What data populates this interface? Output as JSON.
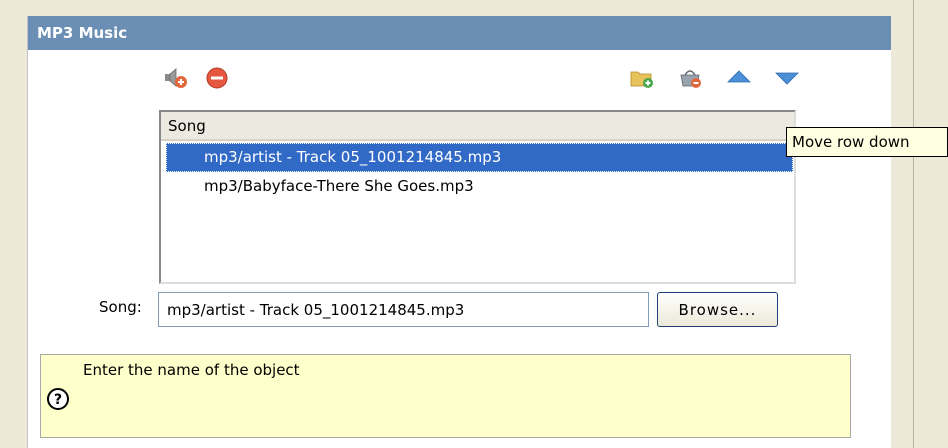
{
  "section": {
    "title": "MP3 Music"
  },
  "toolbar": {
    "left_icons": [
      "speaker-add-icon",
      "remove-icon"
    ],
    "right_icons": [
      "folder-add-icon",
      "basket-remove-icon",
      "move-up-icon",
      "move-down-icon"
    ]
  },
  "list": {
    "column_header": "Song",
    "rows": [
      {
        "value": "mp3/artist - Track 05_1001214845.mp3",
        "selected": true
      },
      {
        "value": "mp3/Babyface-There She Goes.mp3",
        "selected": false
      }
    ]
  },
  "song_field": {
    "label": "Song:",
    "value": "mp3/artist - Track 05_1001214845.mp3"
  },
  "browse_button": {
    "label": "Browse..."
  },
  "help": {
    "text": "Enter the name of the object",
    "icon": "question-circle-icon"
  },
  "tooltip": {
    "text": "Move row down"
  },
  "colors": {
    "header_bar": "#6b8fb4",
    "selection": "#3169c6",
    "help_background": "#ffffcc"
  }
}
